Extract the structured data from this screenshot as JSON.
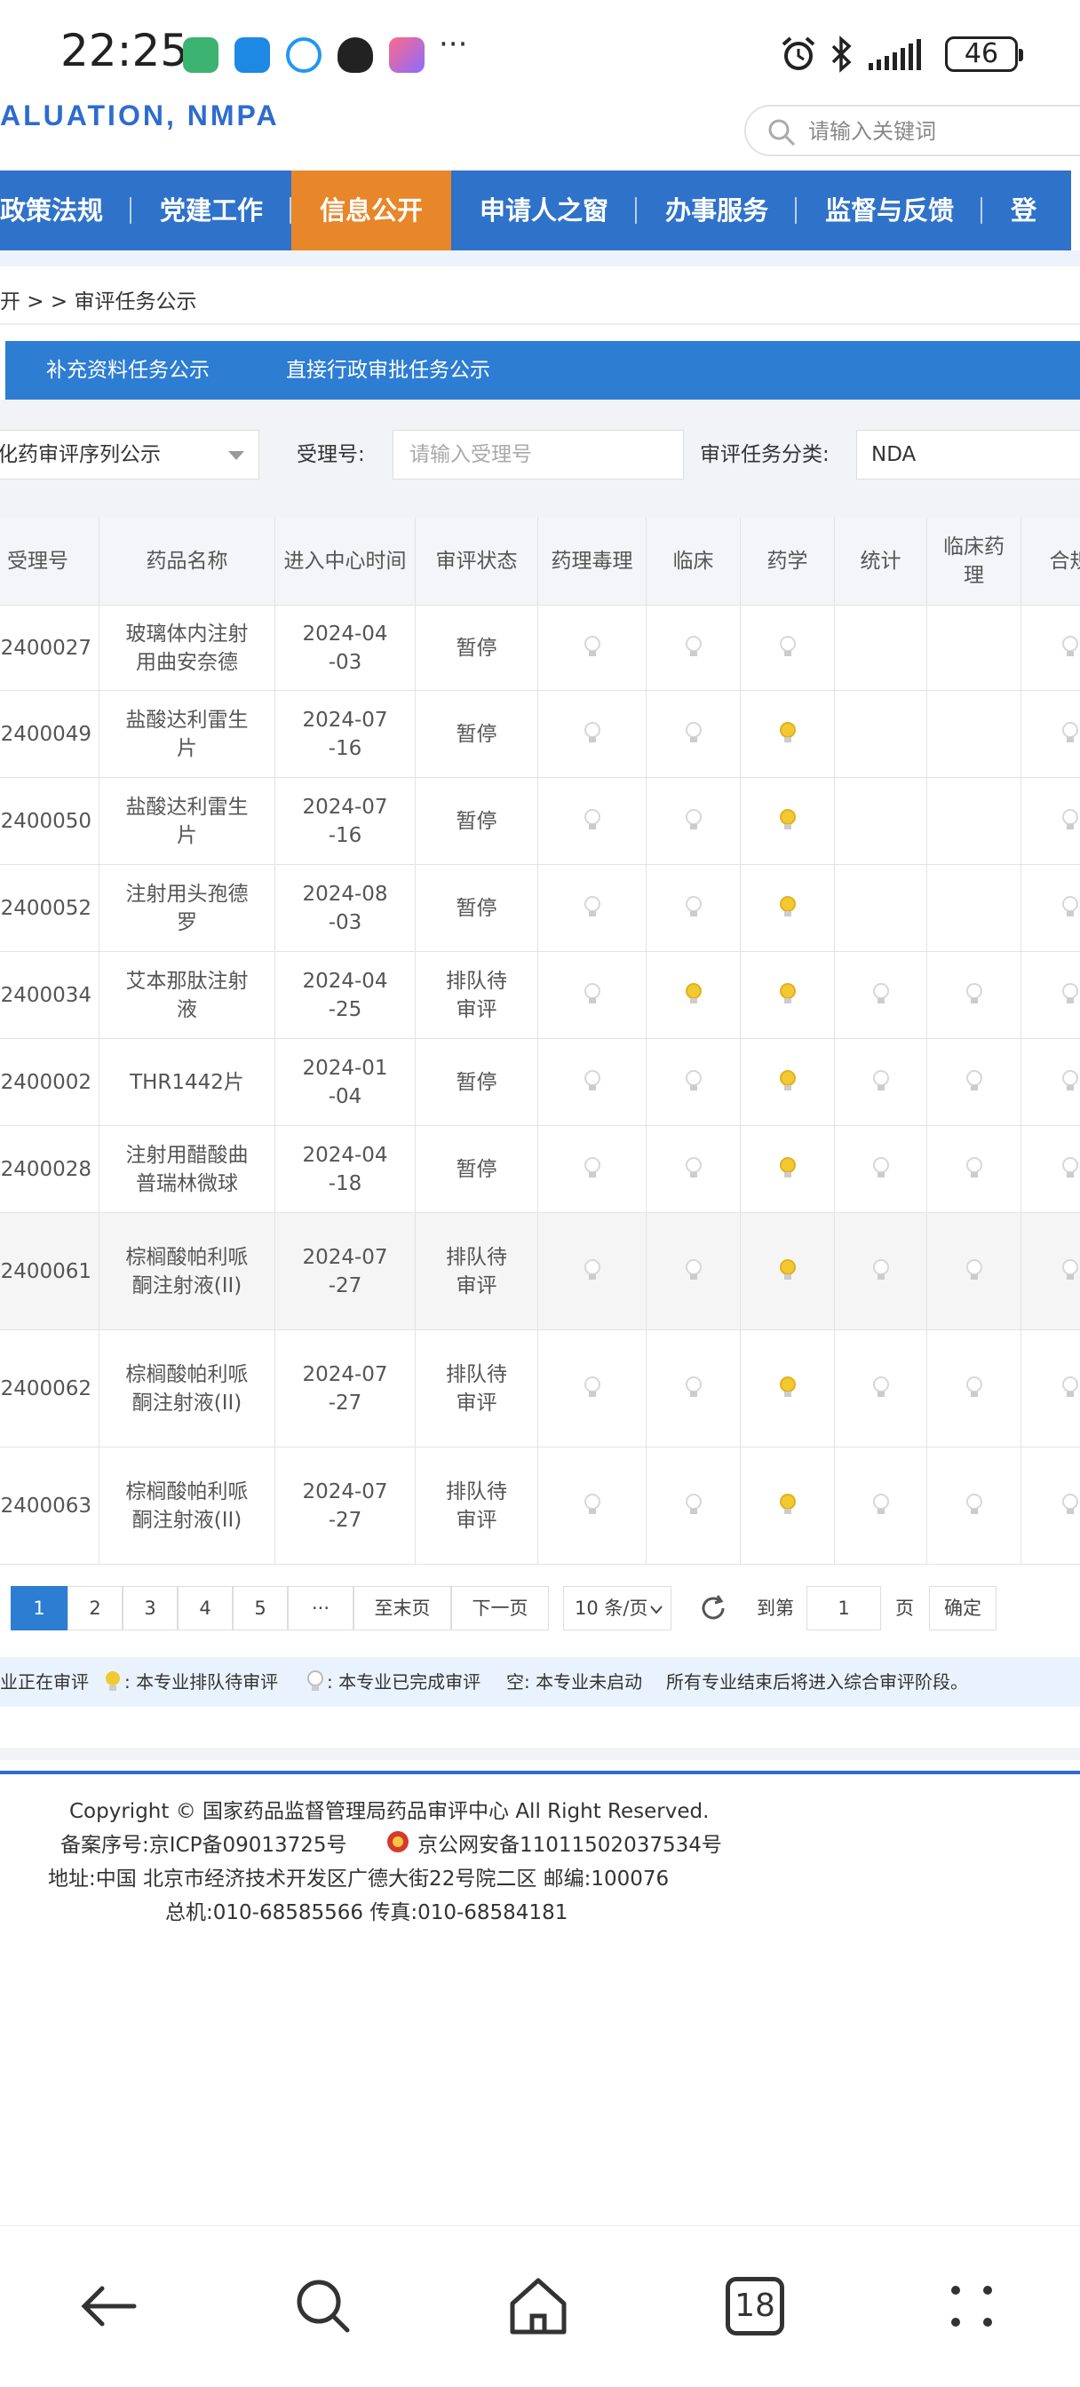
{
  "status_bar": {
    "time": "22:25",
    "battery": "46",
    "icons": [
      "nfc-app-icon",
      "message-icon",
      "chat-bubble-icon",
      "qq-penguin-icon",
      "app-square-icon",
      "more-dots-icon",
      "alarm-icon",
      "bluetooth-icon",
      "signal-icon",
      "battery-icon"
    ]
  },
  "header": {
    "site_title": "ALUATION, NMPA",
    "search_placeholder": "请输入关键词"
  },
  "nav": {
    "items": [
      {
        "label": "政策法规",
        "active": false
      },
      {
        "label": "党建工作",
        "active": false
      },
      {
        "label": "信息公开",
        "active": true
      },
      {
        "label": "申请人之窗",
        "active": false
      },
      {
        "label": "办事服务",
        "active": false
      },
      {
        "label": "监督与反馈",
        "active": false
      },
      {
        "label": "登",
        "active": false
      }
    ]
  },
  "breadcrumb": "开 > > 审评任务公示",
  "subtabs": [
    "补充资料任务公示",
    "直接行政审批任务公示"
  ],
  "filters": {
    "sequence_select": "化药审评序列公示",
    "accept_label": "受理号:",
    "accept_placeholder": "请输入受理号",
    "category_label": "审评任务分类:",
    "category_value": "NDA"
  },
  "table": {
    "headers": [
      "受理号",
      "药品名称",
      "进入中心时间",
      "审评状态",
      "药理毒理",
      "临床",
      "药学",
      "统计",
      "临床药理",
      "合规"
    ],
    "rows": [
      {
        "id": "2400027",
        "name": "玻璃体内注射用曲安奈德",
        "date": "2024-04-03",
        "status": "暂停",
        "marks": [
          "done",
          "done",
          "done",
          "",
          "",
          "done"
        ]
      },
      {
        "id": "2400049",
        "name": "盐酸达利雷生片",
        "date": "2024-07-16",
        "status": "暂停",
        "marks": [
          "done",
          "done",
          "queued",
          "",
          "",
          "done"
        ]
      },
      {
        "id": "2400050",
        "name": "盐酸达利雷生片",
        "date": "2024-07-16",
        "status": "暂停",
        "marks": [
          "done",
          "done",
          "queued",
          "",
          "",
          "done"
        ]
      },
      {
        "id": "2400052",
        "name": "注射用头孢德罗",
        "date": "2024-08-03",
        "status": "暂停",
        "marks": [
          "done",
          "done",
          "queued",
          "",
          "",
          "done"
        ]
      },
      {
        "id": "2400034",
        "name": "艾本那肽注射液",
        "date": "2024-04-25",
        "status": "排队待审评",
        "marks": [
          "done",
          "queued",
          "queued",
          "done",
          "done",
          "done"
        ]
      },
      {
        "id": "2400002",
        "name": "THR1442片",
        "date": "2024-01-04",
        "status": "暂停",
        "marks": [
          "done",
          "done",
          "queued",
          "done",
          "done",
          "done"
        ]
      },
      {
        "id": "2400028",
        "name": "注射用醋酸曲普瑞林微球",
        "date": "2024-04-18",
        "status": "暂停",
        "marks": [
          "done",
          "done",
          "queued",
          "done",
          "done",
          "done"
        ]
      },
      {
        "id": "2400061",
        "name": "棕榈酸帕利哌酮注射液(II)",
        "date": "2024-07-27",
        "status": "排队待审评",
        "marks": [
          "done",
          "done",
          "queued",
          "done",
          "done",
          "done"
        ]
      },
      {
        "id": "2400062",
        "name": "棕榈酸帕利哌酮注射液(II)",
        "date": "2024-07-27",
        "status": "排队待审评",
        "marks": [
          "done",
          "done",
          "queued",
          "done",
          "done",
          "done"
        ]
      },
      {
        "id": "2400063",
        "name": "棕榈酸帕利哌酮注射液(II)",
        "date": "2024-07-27",
        "status": "排队待审评",
        "marks": [
          "done",
          "done",
          "queued",
          "done",
          "done",
          "done"
        ]
      }
    ]
  },
  "pager": {
    "pages": [
      "1",
      "2",
      "3",
      "4",
      "5",
      "···"
    ],
    "last": "至末页",
    "next": "下一页",
    "per_page": "10 条/页",
    "goto_label": "到第",
    "goto_value": "1",
    "page_unit": "页",
    "confirm": "确定"
  },
  "legend": {
    "in_review": "业正在审评",
    "queued": ": 本专业排队待审评",
    "done": ": 本专业已完成审评",
    "empty": "空: 本专业未启动",
    "note": "所有专业结束后将进入综合审评阶段。"
  },
  "footer": {
    "copyright": "Copyright © 国家药品监督管理局药品审评中心   All Right Reserved.",
    "icp": "备案序号:京ICP备09013725号",
    "police": "京公网安备11011502037534号",
    "address": "地址:中国 北京市经济技术开发区广德大街22号院二区     邮编:100076",
    "phone": "总机:010-68585566      传真:010-68584181"
  },
  "colors": {
    "nav_blue": "#2f72c9",
    "nav_active": "#e8862a",
    "bulb_done": "#d7d7d7",
    "bulb_queued": "#f2c930"
  },
  "bottom_nav": {
    "tab_count": "18"
  }
}
